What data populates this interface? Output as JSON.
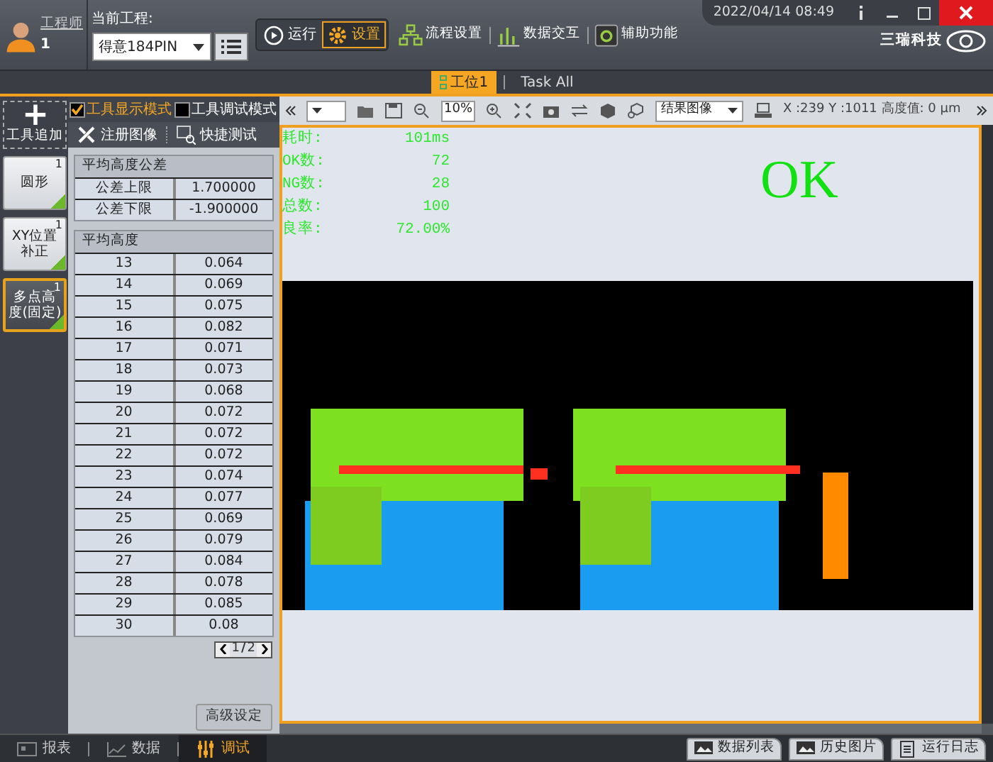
{
  "header": {
    "user": {
      "role": "工程师",
      "id": "1"
    },
    "project_label": "当前工程:",
    "project": "得意184PIN",
    "modes": [
      {
        "label": "运行",
        "selected": false
      },
      {
        "label": "设置",
        "selected": true
      }
    ],
    "menu": [
      {
        "label": "流程设置",
        "kind": "flow"
      },
      {
        "label": "数据交互",
        "kind": "chart"
      },
      {
        "label": "辅助功能",
        "kind": "tool"
      }
    ],
    "datetime": "2022/04/14  08:49",
    "logo": "三瑞科技"
  },
  "station_tabs": [
    {
      "label": "工位1",
      "selected": true
    },
    {
      "label": "Task All",
      "selected": false
    }
  ],
  "tools": {
    "add_label": "工具追加",
    "items": [
      {
        "label": "圆形",
        "count": "1",
        "selected": false
      },
      {
        "label": "XY位置补正",
        "count": "1",
        "selected": false
      },
      {
        "label": "多点高度(固定)",
        "count": "1",
        "selected": true
      }
    ]
  },
  "panel": {
    "modes": [
      {
        "label": "工具显示模式",
        "checked": true
      },
      {
        "label": "工具调试模式",
        "checked": false
      }
    ],
    "actions": [
      {
        "label": "注册图像",
        "kind": "tools"
      },
      {
        "label": "快捷测试",
        "kind": "test"
      }
    ],
    "tolerance": {
      "title": "平均高度公差",
      "rows": [
        [
          "公差上限",
          "1.700000"
        ],
        [
          "公差下限",
          "-1.900000"
        ]
      ]
    },
    "heights": {
      "title": "平均高度",
      "rows": [
        [
          "13",
          "0.064"
        ],
        [
          "14",
          "0.069"
        ],
        [
          "15",
          "0.075"
        ],
        [
          "16",
          "0.082"
        ],
        [
          "17",
          "0.071"
        ],
        [
          "18",
          "0.073"
        ],
        [
          "19",
          "0.068"
        ],
        [
          "20",
          "0.072"
        ],
        [
          "21",
          "0.072"
        ],
        [
          "22",
          "0.072"
        ],
        [
          "23",
          "0.074"
        ],
        [
          "24",
          "0.077"
        ],
        [
          "25",
          "0.069"
        ],
        [
          "26",
          "0.079"
        ],
        [
          "27",
          "0.084"
        ],
        [
          "28",
          "0.078"
        ],
        [
          "29",
          "0.085"
        ],
        [
          "30",
          "0.08"
        ]
      ]
    },
    "pager": {
      "current": "1",
      "separator": "/",
      "total": "2"
    },
    "advanced_button": "高级设定"
  },
  "viewer": {
    "zoom": "10%",
    "image_select": "结果图像",
    "coords": "X :239 Y :1011 高度值: 0 μm",
    "stats": [
      {
        "label": "耗时:",
        "value": "101ms"
      },
      {
        "label": "OK数:",
        "value": "72"
      },
      {
        "label": "NG数:",
        "value": "28"
      },
      {
        "label": "总数:",
        "value": "100"
      },
      {
        "label": "良率:",
        "value": "72.00%"
      }
    ],
    "result": "OK"
  },
  "bottom_tabs": [
    {
      "label": "报表",
      "selected": false,
      "kind": "report"
    },
    {
      "label": "数据",
      "selected": false,
      "kind": "chart"
    },
    {
      "label": "调试",
      "selected": true,
      "kind": "tune"
    }
  ],
  "bottom_buttons": [
    {
      "label": "数据列表",
      "kind": "image"
    },
    {
      "label": "历史图片",
      "kind": "image"
    },
    {
      "label": "运行日志",
      "kind": "log"
    }
  ]
}
